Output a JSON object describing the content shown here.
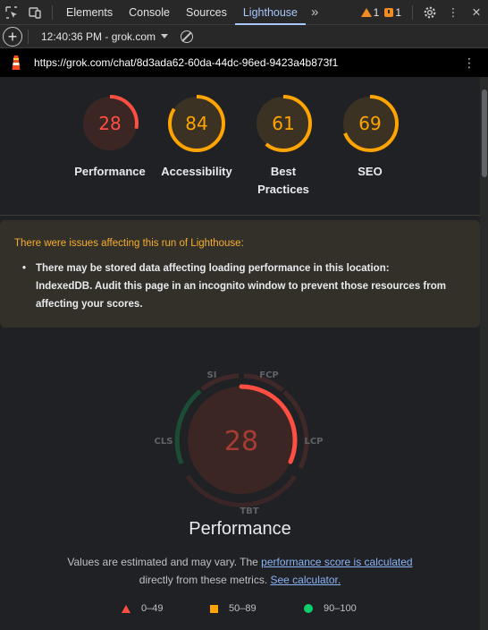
{
  "toolbar": {
    "tabs": [
      "Elements",
      "Console",
      "Sources",
      "Lighthouse"
    ],
    "active_tab": "Lighthouse",
    "warning_count": "1",
    "issue_count": "1"
  },
  "subbar": {
    "report": "12:40:36 PM - grok.com"
  },
  "urlbar": {
    "url": "https://grok.com/chat/8d3ada62-60da-44dc-96ed-9423a4b873f1"
  },
  "scores": [
    {
      "label": "Performance",
      "value": 28,
      "color": "#ff4e42",
      "bg": "#3b2624"
    },
    {
      "label": "Accessibility",
      "value": 84,
      "color": "#ffa400",
      "bg": "#3b3224"
    },
    {
      "label": "Best Practices",
      "value": 61,
      "color": "#ffa400",
      "bg": "#3b3224"
    },
    {
      "label": "SEO",
      "value": 69,
      "color": "#ffa400",
      "bg": "#3b3224"
    }
  ],
  "warning": {
    "title": "There were issues affecting this run of Lighthouse:",
    "items": [
      "There may be stored data affecting loading performance in this location: IndexedDB. Audit this page in an incognito window to prevent those resources from affecting your scores."
    ]
  },
  "performance": {
    "score": "28",
    "title": "Performance",
    "metrics": [
      "SI",
      "FCP",
      "LCP",
      "TBT",
      "CLS"
    ],
    "note_prefix": "Values are estimated and may vary. The ",
    "note_link1": "performance score is calculated",
    "note_middle": "directly from these metrics.",
    "note_link2": "See calculator."
  },
  "legend": [
    {
      "range": "0–49",
      "shape": "triangle",
      "color": "#ff4e42"
    },
    {
      "range": "50–89",
      "shape": "square",
      "color": "#ffa400"
    },
    {
      "range": "90–100",
      "shape": "circle",
      "color": "#0cce6b"
    }
  ]
}
